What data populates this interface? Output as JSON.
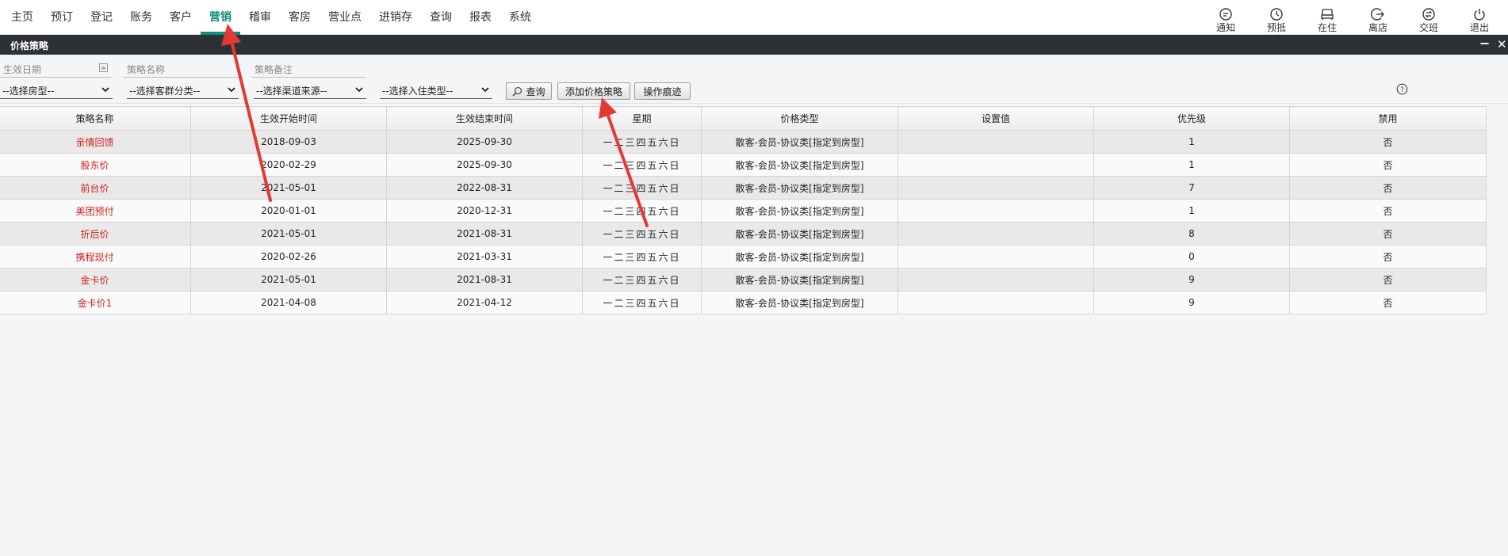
{
  "nav": {
    "items": [
      {
        "label": "主页",
        "active": false
      },
      {
        "label": "预订",
        "active": false
      },
      {
        "label": "登记",
        "active": false
      },
      {
        "label": "账务",
        "active": false
      },
      {
        "label": "客户",
        "active": false
      },
      {
        "label": "营销",
        "active": true
      },
      {
        "label": "稽审",
        "active": false
      },
      {
        "label": "客房",
        "active": false
      },
      {
        "label": "营业点",
        "active": false
      },
      {
        "label": "进销存",
        "active": false
      },
      {
        "label": "查询",
        "active": false
      },
      {
        "label": "报表",
        "active": false
      },
      {
        "label": "系统",
        "active": false
      }
    ],
    "quick": [
      {
        "label": "通知",
        "icon": "notice-icon"
      },
      {
        "label": "预抵",
        "icon": "clock-icon"
      },
      {
        "label": "在住",
        "icon": "bed-icon"
      },
      {
        "label": "离店",
        "icon": "logout-arrow-icon"
      },
      {
        "label": "交班",
        "icon": "handover-icon"
      },
      {
        "label": "退出",
        "icon": "power-icon"
      }
    ],
    "accent_color": "#0d8f7a"
  },
  "window": {
    "title": "价格策略",
    "minimize": "−",
    "close": "✕"
  },
  "filters": {
    "date_placeholder": "生效日期",
    "name_placeholder": "策略名称",
    "remark_placeholder": "策略备注",
    "room_type": "--选择房型--",
    "guest_category": "--选择客群分类--",
    "channel_source": "--选择渠道来源--",
    "checkin_type": "--选择入住类型--",
    "search_button": "查询",
    "add_button": "添加价格策略",
    "log_button": "操作痕迹"
  },
  "table": {
    "headers": [
      "策略名称",
      "生效开始时间",
      "生效结束时间",
      "星期",
      "价格类型",
      "设置值",
      "优先级",
      "禁用"
    ],
    "rows": [
      {
        "name": "亲情回馈",
        "start": "2018-09-03",
        "end": "2025-09-30",
        "week": "一二三四五六日",
        "price_type": "散客-会员-协议类[指定到房型]",
        "value": "",
        "priority": "1",
        "disabled": "否"
      },
      {
        "name": "股东价",
        "start": "2020-02-29",
        "end": "2025-09-30",
        "week": "一二三四五六日",
        "price_type": "散客-会员-协议类[指定到房型]",
        "value": "",
        "priority": "1",
        "disabled": "否"
      },
      {
        "name": "前台价",
        "start": "2021-05-01",
        "end": "2022-08-31",
        "week": "一二三四五六日",
        "price_type": "散客-会员-协议类[指定到房型]",
        "value": "",
        "priority": "7",
        "disabled": "否"
      },
      {
        "name": "美团预付",
        "start": "2020-01-01",
        "end": "2020-12-31",
        "week": "一二三四五六日",
        "price_type": "散客-会员-协议类[指定到房型]",
        "value": "",
        "priority": "1",
        "disabled": "否"
      },
      {
        "name": "折后价",
        "start": "2021-05-01",
        "end": "2021-08-31",
        "week": "一二三四五六日",
        "price_type": "散客-会员-协议类[指定到房型]",
        "value": "",
        "priority": "8",
        "disabled": "否"
      },
      {
        "name": "携程现付",
        "start": "2020-02-26",
        "end": "2021-03-31",
        "week": "一二三四五六日",
        "price_type": "散客-会员-协议类[指定到房型]",
        "value": "",
        "priority": "0",
        "disabled": "否"
      },
      {
        "name": "金卡价",
        "start": "2021-05-01",
        "end": "2021-08-31",
        "week": "一二三四五六日",
        "price_type": "散客-会员-协议类[指定到房型]",
        "value": "",
        "priority": "9",
        "disabled": "否"
      },
      {
        "name": "金卡价1",
        "start": "2021-04-08",
        "end": "2021-04-12",
        "week": "一二三四五六日",
        "price_type": "散客-会员-协议类[指定到房型]",
        "value": "",
        "priority": "9",
        "disabled": "否"
      }
    ]
  },
  "colors": {
    "name_link": "#d32020",
    "titlebar": "#2d3035",
    "annotation_arrow": "#e53935"
  }
}
